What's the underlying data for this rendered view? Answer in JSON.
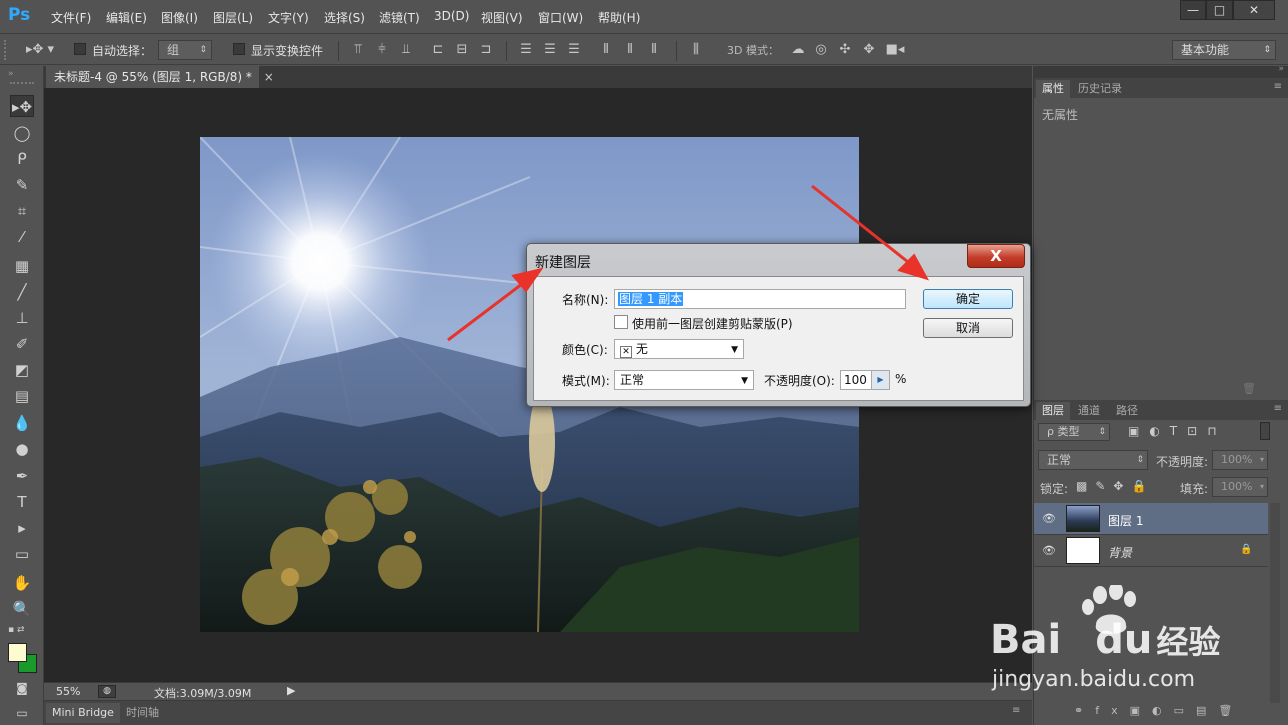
{
  "app": {
    "logo": "Ps",
    "menu": [
      "文件(F)",
      "编辑(E)",
      "图像(I)",
      "图层(L)",
      "文字(Y)",
      "选择(S)",
      "滤镜(T)",
      "3D(D)",
      "视图(V)",
      "窗口(W)",
      "帮助(H)"
    ],
    "window_buttons": {
      "minimize": "—",
      "maximize": "□",
      "close": "✕"
    }
  },
  "options_bar": {
    "auto_select_label": "自动选择：",
    "auto_select_value": "组",
    "show_transform_label": "显示变换控件",
    "mode3d_label": "3D 模式：",
    "workspace": "基本功能"
  },
  "document": {
    "tab_title": "未标题-4 @ 55% (图层 1, RGB/8) *",
    "tab_close": "×"
  },
  "status": {
    "zoom": "55%",
    "doc_info": "文档:3.09M/3.09M"
  },
  "bottom_tabs": [
    "Mini Bridge",
    "时间轴"
  ],
  "properties_panel": {
    "tabs": [
      "属性",
      "历史记录"
    ],
    "empty_text": "无属性"
  },
  "layers_panel": {
    "tabs": [
      "图层",
      "通道",
      "路径"
    ],
    "filter_label": "ρ 类型",
    "blend_mode": "正常",
    "opacity_label": "不透明度:",
    "opacity_value": "100%",
    "lock_label": "锁定:",
    "fill_label": "填充:",
    "fill_value": "100%",
    "layers": [
      {
        "name": "图层 1",
        "selected": true
      },
      {
        "name": "背景",
        "selected": false,
        "locked": true
      }
    ]
  },
  "dialog": {
    "title": "新建图层",
    "close": "X",
    "name_label": "名称(N):",
    "name_value": "图层 1 副本",
    "clip_label": "使用前一图层创建剪贴蒙版(P)",
    "color_label": "颜色(C):",
    "color_value": "无",
    "color_x": "✕",
    "mode_label": "模式(M):",
    "mode_value": "正常",
    "opacity_label": "不透明度(O):",
    "opacity_value": "100",
    "percent": "%",
    "ok": "确定",
    "cancel": "取消"
  },
  "watermark": {
    "brand": "Bai",
    "brand2": "du",
    "suffix": "经验",
    "url": "jingyan.baidu.com"
  },
  "colors": {
    "ui_bg": "#535353",
    "canvas_bg": "#282828",
    "ps_blue": "#31a8ff",
    "selection_blue": "#3399ff",
    "arrow_red": "#e8322a",
    "foreground": "#fffbd0",
    "background": "#1a9a2a"
  }
}
